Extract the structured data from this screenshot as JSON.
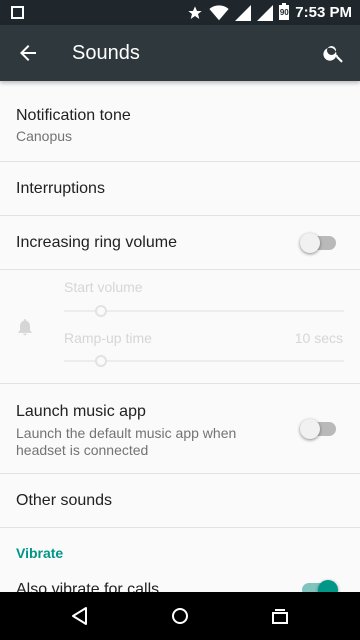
{
  "status_bar": {
    "time": "7:53 PM",
    "battery": "90"
  },
  "app_bar": {
    "title": "Sounds"
  },
  "items": {
    "notification_tone": {
      "label": "Notification tone",
      "value": "Canopus"
    },
    "interruptions": {
      "label": "Interruptions"
    },
    "increasing_ring_volume": {
      "label": "Increasing ring volume",
      "enabled": false
    },
    "start_volume": {
      "label": "Start volume",
      "level": 0
    },
    "ramp_up_time": {
      "label": "Ramp-up time",
      "value": "10 secs",
      "level": 0
    },
    "launch_music_app": {
      "label": "Launch music app",
      "summary": "Launch the default music app when headset is connected",
      "enabled": false
    },
    "other_sounds": {
      "label": "Other sounds"
    }
  },
  "section_vibrate": {
    "header": "Vibrate"
  },
  "vibrate_for_calls": {
    "label": "Also vibrate for calls",
    "enabled": true
  },
  "colors": {
    "accent": "#009688",
    "app_bar": "#2f383d",
    "status_bar": "#1f272c"
  }
}
